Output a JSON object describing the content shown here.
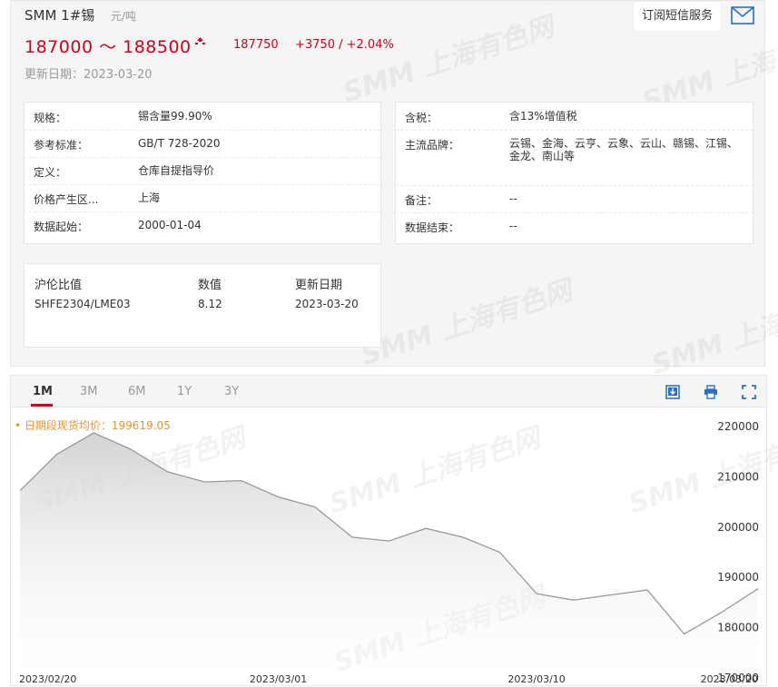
{
  "header": {
    "product": "SMM 1#锡",
    "unit": "元/吨",
    "price_range": "187000 ～ 188500",
    "avg_price": "187750",
    "change": "+3750  /  +2.04%",
    "update_date": "更新日期：2023-03-20",
    "subscribe_label": "订阅短信服务"
  },
  "specs_left": [
    {
      "label": "规格：",
      "value": "锡含量99.90%"
    },
    {
      "label": "参考标准：",
      "value": "GB/T 728-2020"
    },
    {
      "label": "定义：",
      "value": "仓库自提指导价"
    },
    {
      "label": "价格产生区...",
      "value": "上海"
    },
    {
      "label": "数据起始：",
      "value": "2000-01-04"
    }
  ],
  "specs_right": [
    {
      "label": "含税：",
      "value": "含13%增值税"
    },
    {
      "label": "主流品牌：",
      "value": "云锡、金海、云亨、云象、云山、赣锡、江锡、金龙、南山等"
    },
    {
      "label": "备注：",
      "value": "--"
    },
    {
      "label": "数据结束：",
      "value": "--"
    }
  ],
  "ratio_table": {
    "headers": [
      "沪伦比值",
      "数值",
      "更新日期"
    ],
    "row": [
      "SHFE2304/LME03",
      "8.12",
      "2023-03-20"
    ]
  },
  "watermark_text": "SMM 上海有色网",
  "tabs": [
    "1M",
    "3M",
    "6M",
    "1Y",
    "3Y"
  ],
  "active_tab": "1M",
  "avg_label": "• 日期段现货均价：199619.05",
  "colors": {
    "accent": "#d0021b",
    "avg": "#f0932b",
    "line": "#999999"
  },
  "chart_data": {
    "type": "area",
    "x": [
      "2023-02-20",
      "2023-02-21",
      "2023-02-22",
      "2023-02-23",
      "2023-02-24",
      "2023-02-27",
      "2023-02-28",
      "2023-03-01",
      "2023-03-02",
      "2023-03-03",
      "2023-03-06",
      "2023-03-07",
      "2023-03-08",
      "2023-03-09",
      "2023-03-10",
      "2023-03-13",
      "2023-03-14",
      "2023-03-15",
      "2023-03-16",
      "2023-03-17",
      "2023-03-20"
    ],
    "values": [
      207250,
      214500,
      218750,
      215500,
      211000,
      209000,
      209250,
      206000,
      204000,
      198000,
      197250,
      199750,
      198000,
      195000,
      186750,
      185500,
      186500,
      187500,
      178750,
      183000,
      187750
    ],
    "ylim": [
      170000,
      222000
    ],
    "yticks": [
      "220000",
      "210000",
      "200000",
      "190000",
      "180000",
      "170000"
    ],
    "xticks": [
      {
        "label": "2023/02/20",
        "index": 0
      },
      {
        "label": "2023/03/01",
        "index": 7
      },
      {
        "label": "2023/03/10",
        "index": 14
      },
      {
        "label": "2023/03/20",
        "index": 20
      }
    ],
    "title": "",
    "xlabel": "",
    "ylabel": ""
  }
}
